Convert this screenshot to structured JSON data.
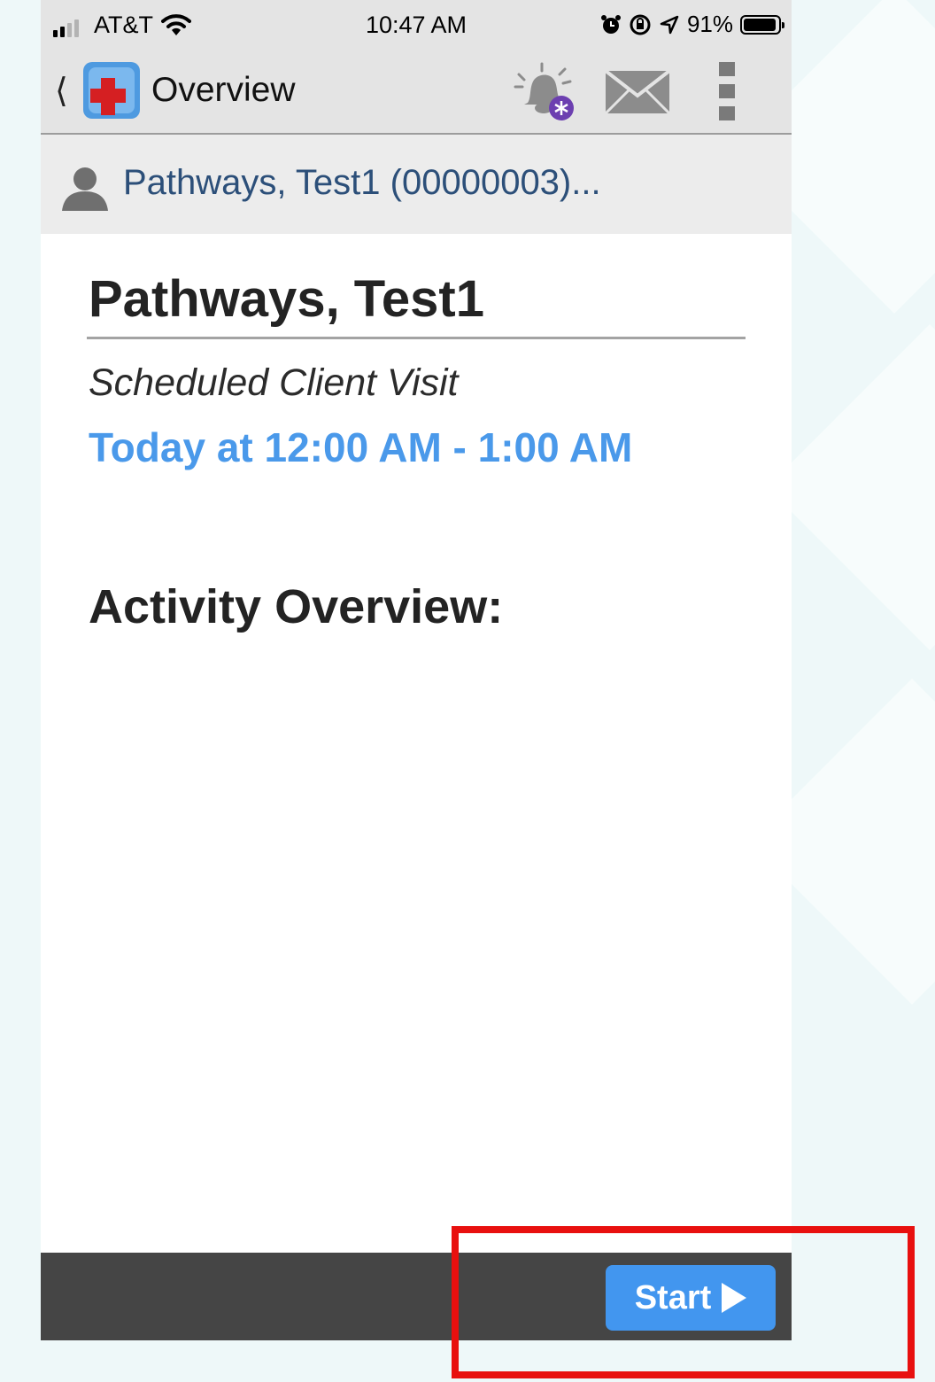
{
  "status_bar": {
    "carrier": "AT&T",
    "time": "10:47 AM",
    "battery": "91%"
  },
  "header": {
    "title": "Overview"
  },
  "patient_banner": {
    "name": "Pathways, Test1 (00000003)..."
  },
  "visit": {
    "client_name": "Pathways, Test1",
    "type": "Scheduled Client Visit",
    "time": "Today at 12:00 AM - 1:00 AM"
  },
  "section": {
    "heading": "Activity Overview:"
  },
  "footer": {
    "start_label": "Start"
  },
  "colors": {
    "accent": "#4296ef",
    "time_text": "#4a99ea",
    "patient_link": "#2c4f79",
    "footer_bg": "#454545",
    "highlight": "#e8100f"
  },
  "icons": [
    "back-chevron-icon",
    "app-logo-icon",
    "alert-bell-icon",
    "mail-icon",
    "more-options-icon",
    "person-icon",
    "play-icon"
  ]
}
